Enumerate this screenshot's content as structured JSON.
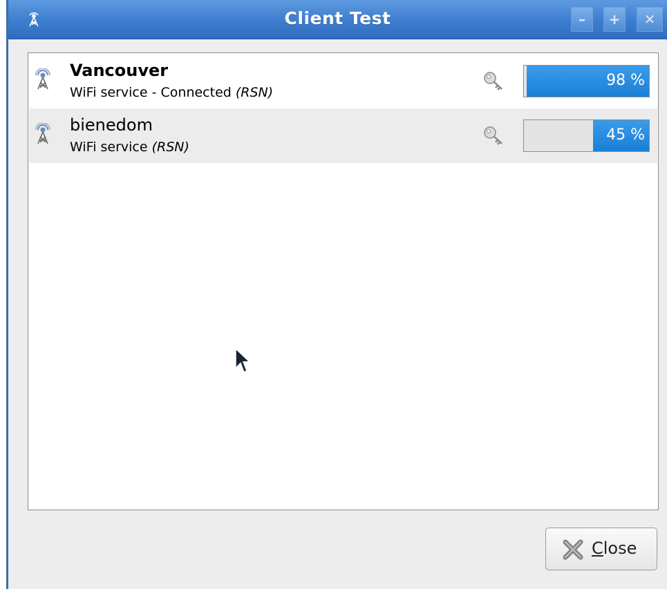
{
  "window": {
    "title": "Client Test"
  },
  "titlebar": {
    "minimize_label": "–",
    "maximize_label": "+",
    "close_label": "✕"
  },
  "networks": [
    {
      "name": "Vancouver",
      "service": "WiFi service - Connected",
      "security": "(RSN)",
      "strength": 98,
      "strength_label": "98 %"
    },
    {
      "name": "bienedom",
      "service": "WiFi service",
      "security": "(RSN)",
      "strength": 45,
      "strength_label": "45 %"
    }
  ],
  "close_button": {
    "label_first": "C",
    "label_rest": "lose"
  },
  "colors": {
    "titlebar": "#3f7fd0",
    "progress": "#1a7fd8",
    "row_alt": "#ececec"
  },
  "icons": {
    "app": "wifi-tower-icon",
    "network": "wifi-tower-icon",
    "secured": "key-icon",
    "close": "close-x-icon"
  }
}
